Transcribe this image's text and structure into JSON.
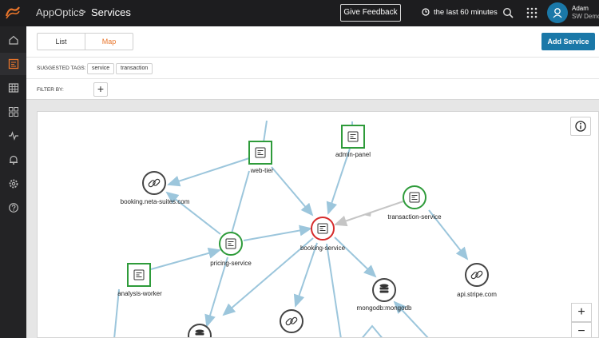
{
  "app": {
    "name": "AppOptics",
    "separator": ">",
    "page_title": "Services"
  },
  "topbar": {
    "feedback_label": "Give Feedback",
    "time_range": "the last 60 minutes",
    "user_name": "Adam",
    "user_org": "SW Demo"
  },
  "sidebar": {
    "items": [
      {
        "icon": "home-icon",
        "active": false
      },
      {
        "icon": "services-icon",
        "active": true
      },
      {
        "icon": "table-icon",
        "active": false
      },
      {
        "icon": "dashboards-icon",
        "active": false
      },
      {
        "icon": "pulse-icon",
        "active": false
      },
      {
        "icon": "bell-icon",
        "active": false
      },
      {
        "icon": "settings-icon",
        "active": false
      },
      {
        "icon": "help-icon",
        "active": false
      }
    ]
  },
  "view_toggle": {
    "list_label": "List",
    "map_label": "Map",
    "selected": "Map"
  },
  "add_service_label": "Add Service",
  "tags": {
    "label": "SUGGESTED TAGS:",
    "items": [
      "service",
      "transaction"
    ]
  },
  "filter": {
    "label": "FILTER BY:",
    "add_label": "+"
  },
  "map": {
    "nodes": [
      {
        "label": "web-tier",
        "kind": "service",
        "status": "ok"
      },
      {
        "label": "admin-panel",
        "kind": "service",
        "status": "ok"
      },
      {
        "label": "booking.neta-suites.com",
        "kind": "external",
        "status": "neutral"
      },
      {
        "label": "transaction-service",
        "kind": "service",
        "status": "ok"
      },
      {
        "label": "booking-service",
        "kind": "service",
        "status": "error"
      },
      {
        "label": "pricing-service",
        "kind": "service",
        "status": "ok"
      },
      {
        "label": "analysis-worker",
        "kind": "service",
        "status": "ok"
      },
      {
        "label": "mongodb:mongodb",
        "kind": "database",
        "status": "neutral"
      },
      {
        "label": "api.stripe.com",
        "kind": "external",
        "status": "neutral"
      }
    ],
    "info_label": "i",
    "zoom_in_label": "+",
    "zoom_out_label": "−"
  },
  "colors": {
    "accent": "#e8752b",
    "primary": "#1a78a8",
    "ok": "#2e9b3a",
    "error": "#d62b2b",
    "neutral": "#444444",
    "edge": "#9cc6dc"
  }
}
